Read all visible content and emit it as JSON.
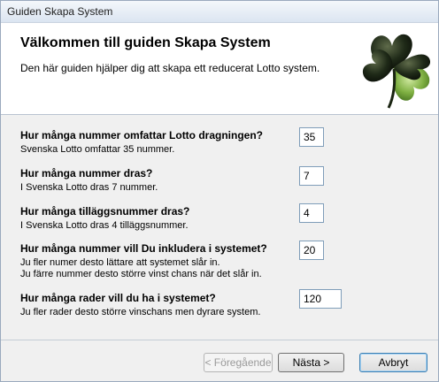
{
  "window": {
    "title": "Guiden Skapa System"
  },
  "header": {
    "heading": "Välkommen till guiden Skapa System",
    "subheading": "Den här guiden hjälper dig att skapa ett reducerat Lotto system."
  },
  "questions": [
    {
      "label": "Hur många nummer omfattar Lotto dragningen?",
      "help": [
        "Svenska Lotto omfattar 35 nummer."
      ],
      "value": "35"
    },
    {
      "label": "Hur många nummer dras?",
      "help": [
        "I Svenska Lotto dras 7 nummer."
      ],
      "value": "7"
    },
    {
      "label": "Hur många tilläggsnummer dras?",
      "help": [
        "I Svenska Lotto dras 4 tilläggsnummer."
      ],
      "value": "4"
    },
    {
      "label": "Hur många nummer vill Du inkludera i systemet?",
      "help": [
        "Ju fler numer desto lättare att systemet slår in.",
        "Ju färre nummer desto större vinst chans när det slår in."
      ],
      "value": "20"
    },
    {
      "label": "Hur många rader vill du ha i systemet?",
      "help": [
        "Ju fler rader desto större vinschans men dyrare system."
      ],
      "value": "120"
    }
  ],
  "buttons": {
    "back": "< Föregående",
    "next": "Nästa >",
    "cancel": "Avbryt"
  },
  "icons": {
    "logo": "four-leaf-clover-icon"
  }
}
